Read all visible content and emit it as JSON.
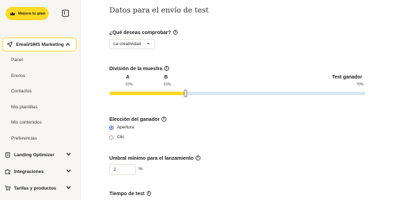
{
  "sidebar": {
    "upgrade_label": "Mejora tu plan",
    "active_menu": "Email/SMS Marketing",
    "subitems": [
      "Panel",
      "Envíos",
      "Contactos",
      "Mis plantillas",
      "Mis contenidos",
      "Preferencias"
    ],
    "groups": [
      "Landing Optimizer",
      "Integraciones",
      "Tarifas y productos"
    ]
  },
  "main": {
    "title": "Datos para el envío de test",
    "compare": {
      "label": "¿Qué deseas comprobar?",
      "selected": "La creatividad"
    },
    "split": {
      "label": "División de la muestra",
      "a_label": "A",
      "a_pct": "15%",
      "b_label": "B",
      "b_pct": "15%",
      "winner_label": "Test ganador",
      "winner_pct": "70%",
      "test_fraction": 0.3
    },
    "winner_choice": {
      "label": "Elección del ganador",
      "options": [
        "Apertura",
        "Clic"
      ],
      "selected": "Apertura"
    },
    "threshold": {
      "label": "Umbral mínimo para el lanzamiento",
      "value": "2",
      "suffix": "%"
    },
    "test_time": {
      "label": "Tiempo de test"
    }
  },
  "colors": {
    "accent": "#ffd924",
    "radio": "#1a56c8",
    "track": "#dce6ee",
    "sidebar_bg": "#f7f6f2"
  }
}
